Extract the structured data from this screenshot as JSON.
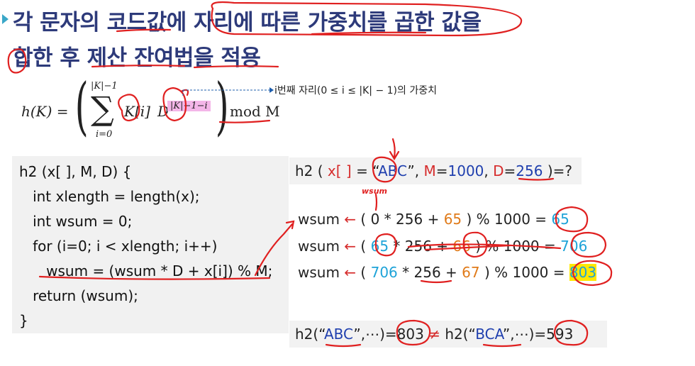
{
  "title": {
    "line1": "각 문자의 코드값에 자리에 따른 가중치를 곱한 값을",
    "line2": "합한 후 제산 잔여법을 적용"
  },
  "formula": {
    "lhs": "h(K) =",
    "sigma_upper": "|K|−1",
    "sigma_lower": "i=0",
    "term": "K[i]",
    "base": "D",
    "exponent": "|K|−1−i",
    "mod": "mod M",
    "annotation": "i번째 자리(0 ≤ i ≤ |K| − 1)의 가중치"
  },
  "code": {
    "lines": [
      "h2 (x[ ], M, D) {",
      "   int xlength = length(x);",
      "   int wsum = 0;",
      "   for (i=0; i < xlength; i++)",
      "      wsum = (wsum * D + x[i]) % M;",
      "   return (wsum);",
      "}"
    ]
  },
  "question": {
    "prefix": "h2 ( ",
    "x_label": "x[ ]",
    "eq": " = “",
    "str": "ABC",
    "close_q": "”, ",
    "m_label": "M",
    "m_eq": "=",
    "m_val": "1000",
    "comma": ", ",
    "d_label": "D",
    "d_eq": "=",
    "d_val": "256",
    "end": " )=?"
  },
  "handwritten_note": "wsum",
  "steps": [
    {
      "var": "wsum",
      "arrow": "←",
      "open": "( ",
      "prev": "0",
      "mul": " * 256 + ",
      "code": "65",
      "mod": " ) % 1000 = ",
      "result": "65"
    },
    {
      "var": "wsum",
      "arrow": "←",
      "open": "( ",
      "prev": "65",
      "mul": " * 256 + ",
      "code": "66",
      "mod": " ) % 1000 = ",
      "result": "706"
    },
    {
      "var": "wsum",
      "arrow": "←",
      "open": "( ",
      "prev": "706",
      "mul": " * 256 + ",
      "code": "67",
      "mod": " ) % 1000 = ",
      "result": "803"
    }
  ],
  "compare": {
    "a_pre": "h2(“",
    "a_str": "ABC",
    "a_post": "”,⋯)=",
    "a_val": "803",
    "neq": " ≠ ",
    "b_pre": "h2(“",
    "b_str": "BCA",
    "b_post": "”,⋯)=",
    "b_val": "593"
  },
  "colors": {
    "title": "#2d3a7a",
    "bullet": "#3aa7c8",
    "blue": "#1f3fae",
    "red": "#d62c2c",
    "orange": "#e07b1a",
    "cyan": "#1ea3d8",
    "highlight_yellow": "#ffe800",
    "highlight_pink": "#f4b6e8",
    "ink_red": "#e02020"
  }
}
